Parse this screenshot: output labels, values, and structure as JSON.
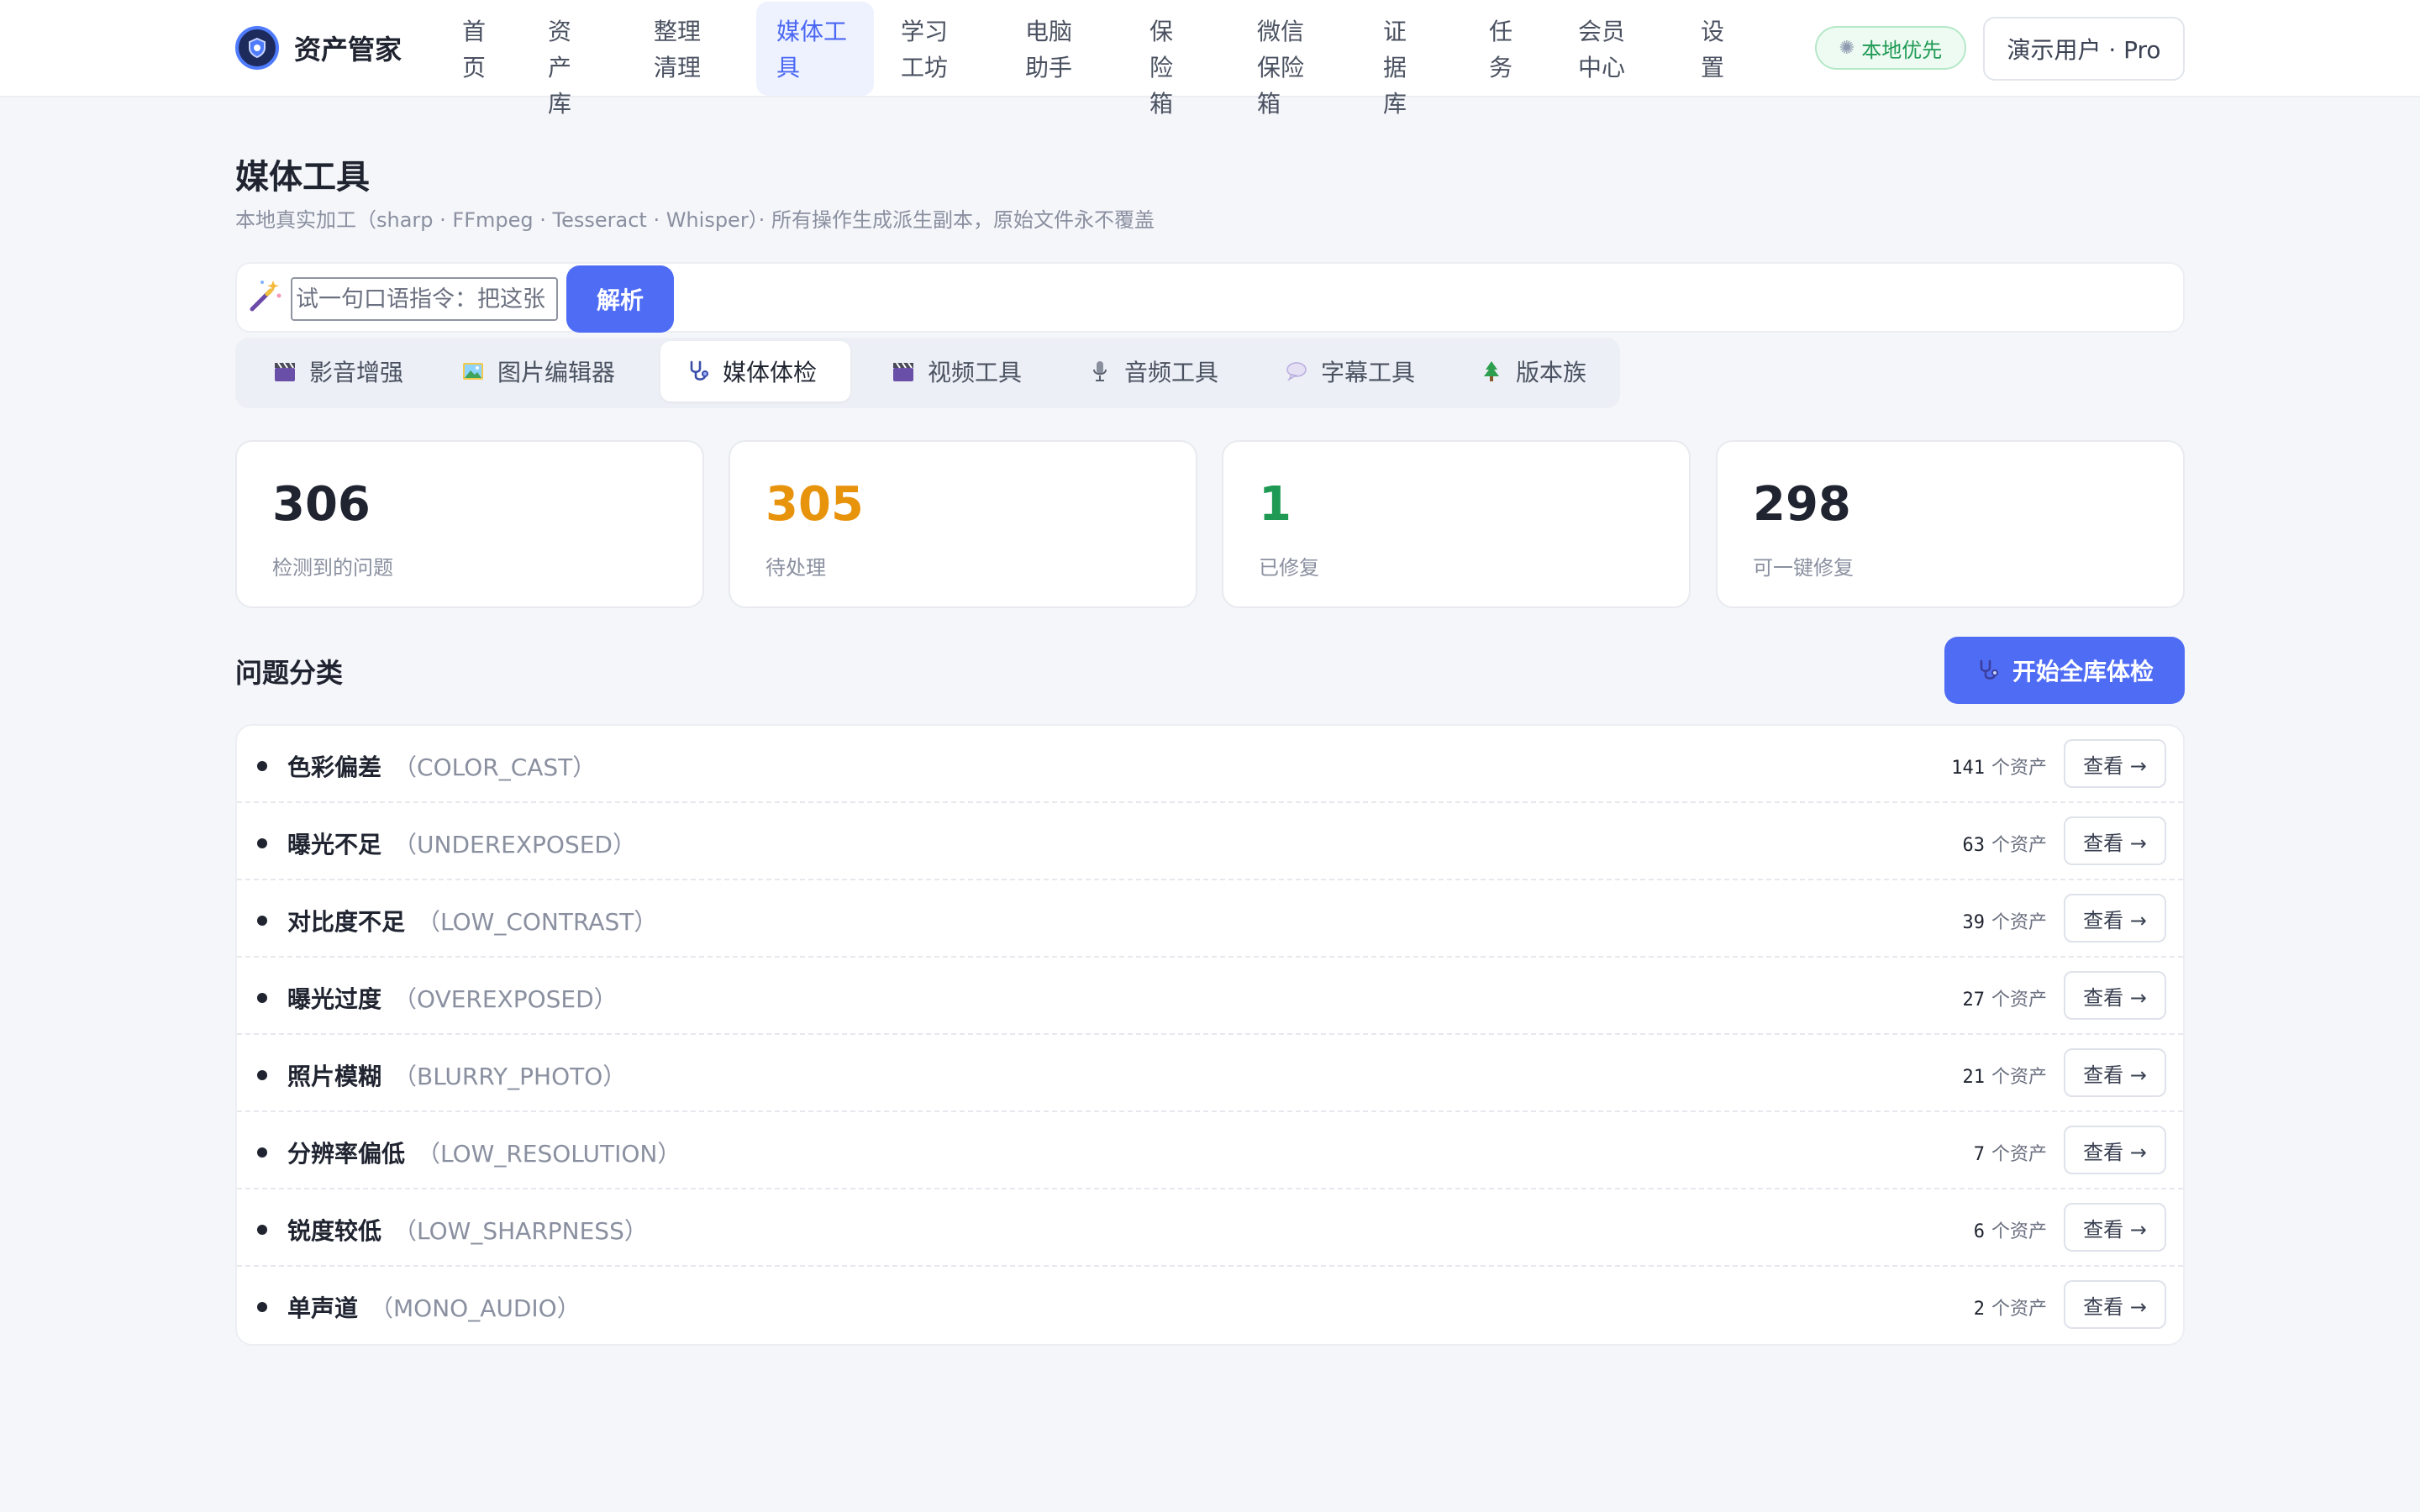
{
  "app": {
    "name": "资产管家"
  },
  "nav": {
    "items": [
      {
        "label": "首页"
      },
      {
        "label": "资产库"
      },
      {
        "label": "整理清理"
      },
      {
        "label": "媒体工具"
      },
      {
        "label": "学习工坊"
      },
      {
        "label": "电脑助手"
      },
      {
        "label": "保险箱"
      },
      {
        "label": "微信保险箱"
      },
      {
        "label": "证据库"
      },
      {
        "label": "任务"
      },
      {
        "label": "会员中心"
      },
      {
        "label": "设置"
      }
    ],
    "active_index": 3
  },
  "header": {
    "local_badge": "本地优先",
    "user": "演示用户 · Pro"
  },
  "page": {
    "title": "媒体工具",
    "subtitle": "本地真实加工（sharp · FFmpeg · Tesseract · Whisper）· 所有操作生成派生副本，原始文件永不覆盖"
  },
  "command": {
    "placeholder": "试一句口语指令：把这张",
    "parse_label": "解析"
  },
  "tabs": [
    {
      "label": "影音增强",
      "icon": "clapper-icon"
    },
    {
      "label": "图片编辑器",
      "icon": "picture-icon"
    },
    {
      "label": "媒体体检",
      "icon": "stethoscope-icon"
    },
    {
      "label": "视频工具",
      "icon": "clapper-icon"
    },
    {
      "label": "音频工具",
      "icon": "microphone-icon"
    },
    {
      "label": "字幕工具",
      "icon": "speech-bubble-icon"
    },
    {
      "label": "版本族",
      "icon": "tree-icon"
    }
  ],
  "active_tab": 2,
  "stats": [
    {
      "value": "306",
      "label": "检测到的问题",
      "color": "#1f2430"
    },
    {
      "value": "305",
      "label": "待处理",
      "color": "#e8930c"
    },
    {
      "value": "1",
      "label": "已修复",
      "color": "#1f9a55"
    },
    {
      "value": "298",
      "label": "可一键修复",
      "color": "#1f2430"
    }
  ],
  "issues": {
    "title": "问题分类",
    "scan_label": "开始全库体检",
    "unit": "个资产",
    "view_label": "查看 →",
    "rows": [
      {
        "name": "色彩偏差",
        "code": "（COLOR_CAST）",
        "count": "141"
      },
      {
        "name": "曝光不足",
        "code": "（UNDEREXPOSED）",
        "count": "63"
      },
      {
        "name": "对比度不足",
        "code": "（LOW_CONTRAST）",
        "count": "39"
      },
      {
        "name": "曝光过度",
        "code": "（OVEREXPOSED）",
        "count": "27"
      },
      {
        "name": "照片模糊",
        "code": "（BLURRY_PHOTO）",
        "count": "21"
      },
      {
        "name": "分辨率偏低",
        "code": "（LOW_RESOLUTION）",
        "count": "7"
      },
      {
        "name": "锐度较低",
        "code": "（LOW_SHARPNESS）",
        "count": "6"
      },
      {
        "name": "单声道",
        "code": "（MONO_AUDIO）",
        "count": "2"
      }
    ]
  },
  "colors": {
    "accent": "#4f6cf5",
    "pending": "#e8930c",
    "fixed": "#1f9a55"
  }
}
